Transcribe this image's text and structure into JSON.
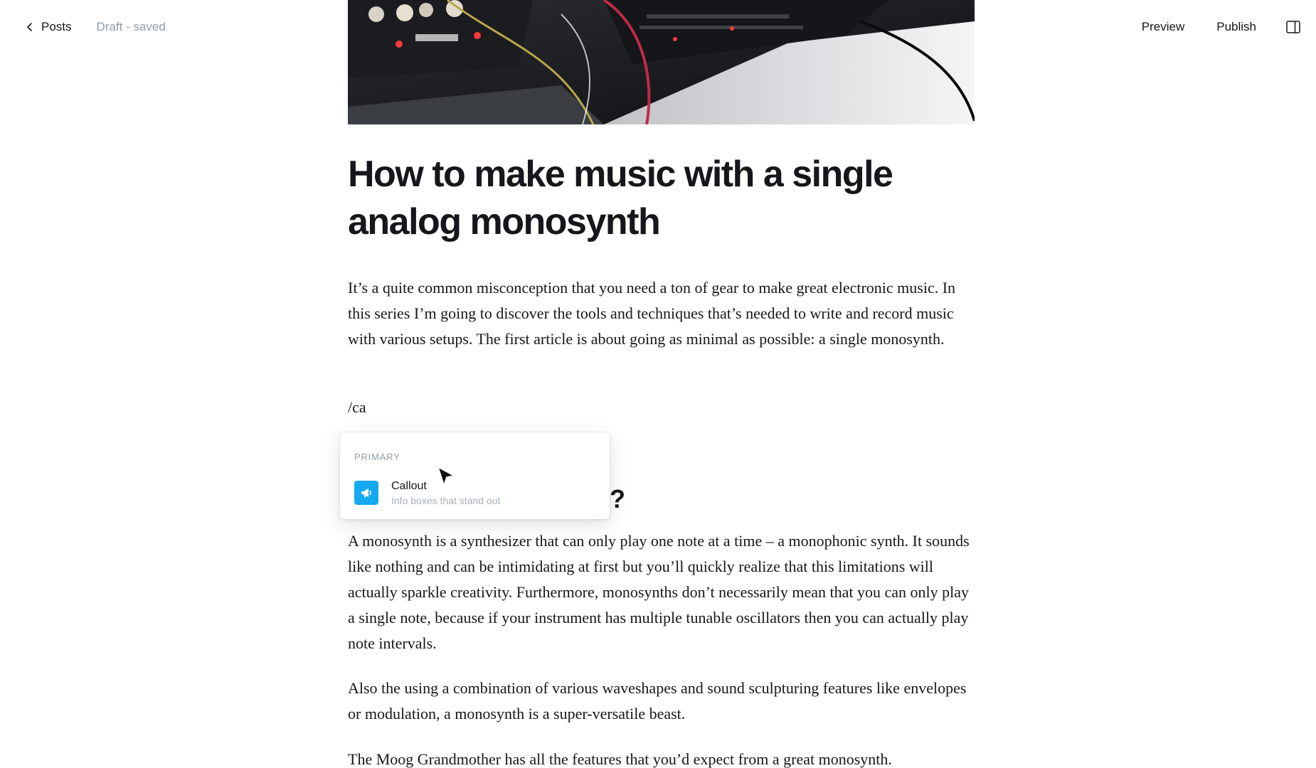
{
  "header": {
    "back_label": "Posts",
    "status": "Draft - saved",
    "preview_label": "Preview",
    "publish_label": "Publish"
  },
  "post": {
    "title": "How to make music with a single analog monosynth",
    "paragraph_1": "It’s a quite common misconception that you need a ton of gear to make great electronic music. In this series I’m going to discover the tools and techniques that’s needed to write and record music with various setups. The first article is about going as minimal as possible: a single monosynth.",
    "slash_input": "/ca",
    "heading_visible_fragment": "?",
    "paragraph_2": "A monosynth is a synthesizer that can only play one note at a time – a monophonic synth. It sounds like nothing and can be intimidating at first but you’ll quickly realize that this limitations will actually sparkle creativity. Furthermore, monosynths don’t necessarily mean that you can only play a single note, because if your instrument has multiple tunable oscillators then you can actually play note intervals.",
    "paragraph_3": "Also the using a combination of various waveshapes and sound sculpturing features like envelopes or modulation, a monosynth is a super-versatile beast.",
    "paragraph_4": "The Moog Grandmother has all the features that you’d expect from a great monosynth."
  },
  "slash_menu": {
    "section_label": "PRIMARY",
    "items": [
      {
        "title": "Callout",
        "description": "Info boxes that stand out",
        "icon": "megaphone-icon",
        "icon_color": "#14a9f0"
      }
    ]
  },
  "colors": {
    "text": "#15171a",
    "muted": "#8e9cac",
    "accent": "#14a9f0"
  }
}
